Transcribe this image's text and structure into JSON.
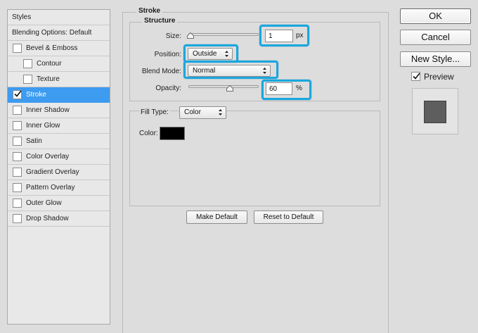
{
  "sidebar": {
    "header": "Styles",
    "blending_options": "Blending Options: Default",
    "items": [
      {
        "label": "Bevel & Emboss",
        "checked": false,
        "indent": false,
        "selected": false
      },
      {
        "label": "Contour",
        "checked": false,
        "indent": true,
        "selected": false
      },
      {
        "label": "Texture",
        "checked": false,
        "indent": true,
        "selected": false
      },
      {
        "label": "Stroke",
        "checked": true,
        "indent": false,
        "selected": true
      },
      {
        "label": "Inner Shadow",
        "checked": false,
        "indent": false,
        "selected": false
      },
      {
        "label": "Inner Glow",
        "checked": false,
        "indent": false,
        "selected": false
      },
      {
        "label": "Satin",
        "checked": false,
        "indent": false,
        "selected": false
      },
      {
        "label": "Color Overlay",
        "checked": false,
        "indent": false,
        "selected": false
      },
      {
        "label": "Gradient Overlay",
        "checked": false,
        "indent": false,
        "selected": false
      },
      {
        "label": "Pattern Overlay",
        "checked": false,
        "indent": false,
        "selected": false
      },
      {
        "label": "Outer Glow",
        "checked": false,
        "indent": false,
        "selected": false
      },
      {
        "label": "Drop Shadow",
        "checked": false,
        "indent": false,
        "selected": false
      }
    ]
  },
  "stroke": {
    "title": "Stroke",
    "structure": {
      "title": "Structure",
      "size_label": "Size:",
      "size_value": "1",
      "size_unit": "px",
      "size_slider_level": 0.0,
      "position_label": "Position:",
      "position_value": "Outside",
      "blend_mode_label": "Blend Mode:",
      "blend_mode_value": "Normal",
      "opacity_label": "Opacity:",
      "opacity_value": "60",
      "opacity_unit": "%",
      "opacity_slider_level": 0.6
    },
    "fill": {
      "fill_type_label": "Fill Type:",
      "fill_type_value": "Color",
      "color_label": "Color:",
      "color_swatch": "#000000"
    },
    "make_default": "Make Default",
    "reset_to_default": "Reset to Default"
  },
  "buttons": {
    "ok": "OK",
    "cancel": "Cancel",
    "new_style": "New Style...",
    "preview_label": "Preview",
    "preview_checked": true
  },
  "preview_swatch_color": "#5e5e5e",
  "colors": {
    "highlight": "#1aa7dd",
    "selection": "#3d9bf0"
  },
  "icons": {
    "checkmark": "check-icon",
    "dropdown": "updown-arrows-icon",
    "slider": "slider-thumb-icon"
  }
}
